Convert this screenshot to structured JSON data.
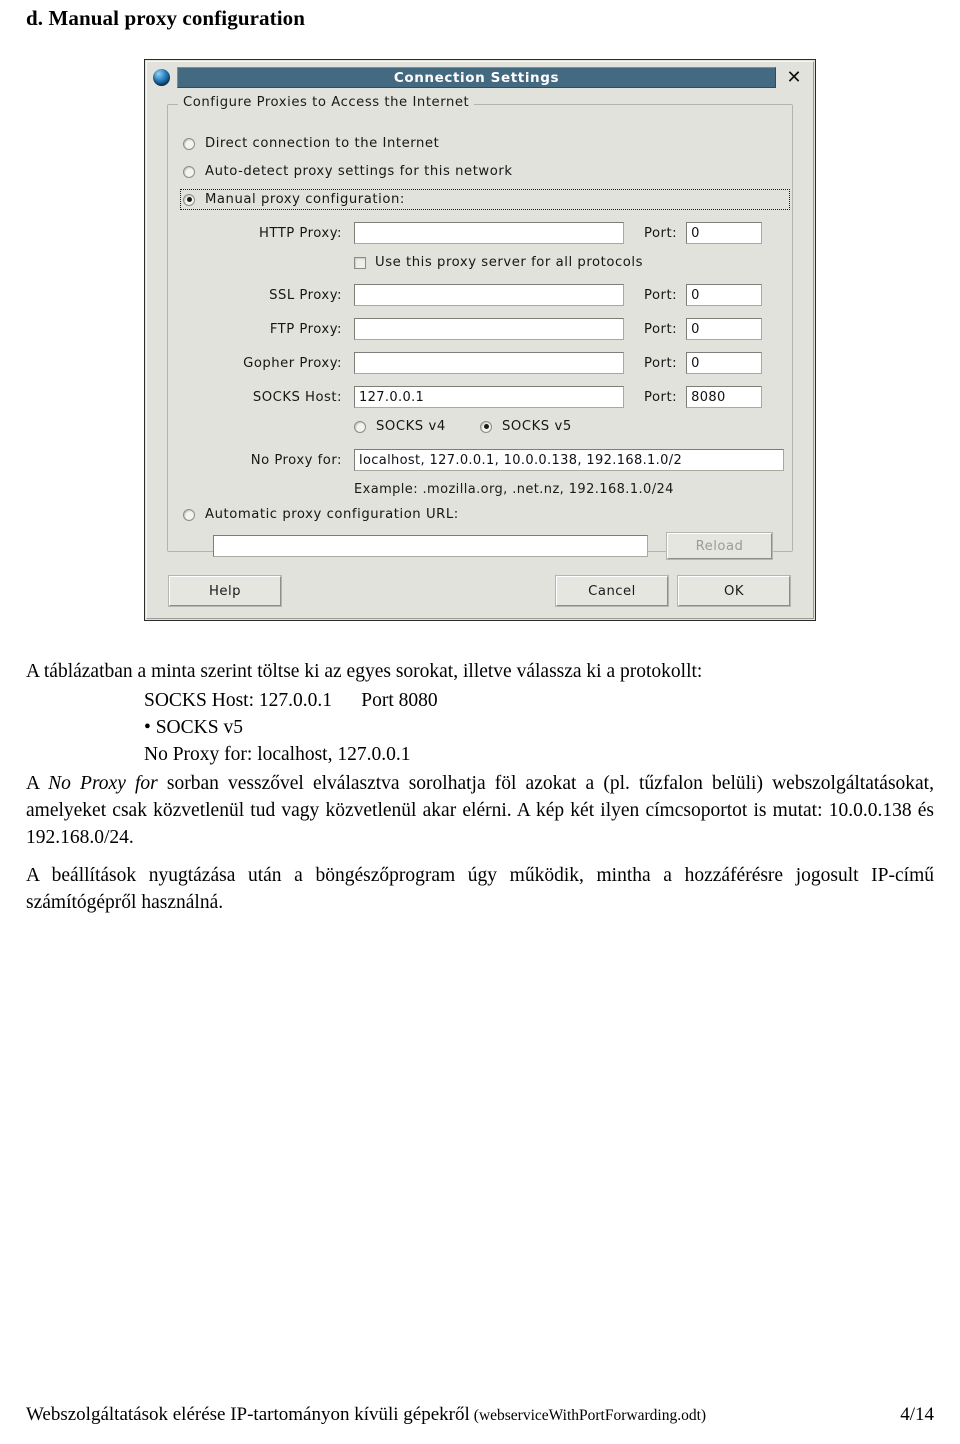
{
  "page": {
    "heading": "d. Manual proxy configuration"
  },
  "dialog": {
    "title": "Connection Settings",
    "close_icon": "close-icon",
    "groupbox_legend": "Configure Proxies to Access the Internet",
    "radios": [
      {
        "label": "Direct connection to the Internet",
        "checked": false
      },
      {
        "label": "Auto-detect proxy settings for this network",
        "checked": false
      },
      {
        "label": "Manual proxy configuration:",
        "checked": true
      }
    ],
    "fields": [
      {
        "label": "HTTP Proxy:",
        "value": "",
        "port_label": "Port:",
        "port_value": "0"
      },
      {
        "label": "SSL Proxy:",
        "value": "",
        "port_label": "Port:",
        "port_value": "0"
      },
      {
        "label": "FTP Proxy:",
        "value": "",
        "port_label": "Port:",
        "port_value": "0"
      },
      {
        "label": "Gopher Proxy:",
        "value": "",
        "port_label": "Port:",
        "port_value": "0"
      },
      {
        "label": "SOCKS Host:",
        "value": "127.0.0.1",
        "port_label": "Port:",
        "port_value": "8080"
      }
    ],
    "all_protocols_checkbox": {
      "label": "Use this proxy server for all protocols",
      "checked": false
    },
    "socks_version": [
      {
        "label": "SOCKS v4",
        "checked": false
      },
      {
        "label": "SOCKS v5",
        "checked": true
      }
    ],
    "no_proxy": {
      "label": "No Proxy for:",
      "value": "localhost, 127.0.0.1, 10.0.0.138, 192.168.1.0/2",
      "example": "Example: .mozilla.org, .net.nz, 192.168.1.0/24"
    },
    "auto_config": {
      "label": "Automatic proxy configuration URL:",
      "checked": false,
      "value": "",
      "reload_label": "Reload"
    },
    "buttons": {
      "help": "Help",
      "cancel": "Cancel",
      "ok": "OK"
    },
    "colors": {
      "titlebar": "#436a80",
      "face": "#e2e2dd",
      "border": "#2b2b2b"
    }
  },
  "content": {
    "intro": "A táblázatban a minta szerint töltse ki az egyes sorokat, illetve válassza ki a protokollt:",
    "list": [
      "SOCKS Host: 127.0.0.1      Port 8080",
      "• SOCKS v5",
      "No Proxy for: localhost, 127.0.0.1"
    ],
    "para2_a": "A ",
    "para2_italic": "No Proxy for",
    "para2_b": " sorban vesszővel elválasztva sorolhatja föl azokat a (pl. tűzfalon belüli) webszolgáltatásokat, amelyeket csak közvetlenül tud vagy közvetlenül akar elérni. A kép két ilyen címcsoportot is mutat: 10.0.0.138 és 192.168.0/24.",
    "para3": "A beállítások nyugtázása után a böngészőprogram úgy működik, mintha a hozzáférésre jogosult IP-című számítógépről használná."
  },
  "footer": {
    "title": "Webszolgáltatások elérése IP-tartományon kívüli gépekről",
    "file": "(webserviceWithPortForwarding.odt)",
    "page": "4/14"
  }
}
